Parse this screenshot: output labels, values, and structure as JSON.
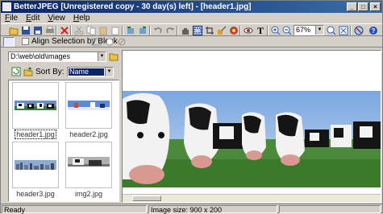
{
  "window": {
    "title": "BetterJPEG [Unregistered copy - 30 day(s) left] - [header1.jpg]"
  },
  "menu": [
    "File",
    "Edit",
    "View",
    "Help"
  ],
  "toolbar": {
    "zoom_value": "67%"
  },
  "toolbar2": {
    "align_label": "Align Selection by Block",
    "align_checked": false
  },
  "browser": {
    "path": "D:\\web\\old\\images",
    "sort_label": "Sort By:",
    "sort_value": "Name",
    "thumbnails": [
      {
        "name": "header1.jpg",
        "selected": true
      },
      {
        "name": "header2.jpg",
        "selected": false
      },
      {
        "name": "header3.jpg",
        "selected": false
      },
      {
        "name": "img2.jpg",
        "selected": false
      }
    ]
  },
  "status": {
    "ready": "Ready",
    "image_size": "Image size:  900 x 200"
  },
  "colors": {
    "titlebar_start": "#0a246a",
    "titlebar_end": "#3a6ea5",
    "face": "#d4d0c8",
    "selection": "#0a246a"
  }
}
